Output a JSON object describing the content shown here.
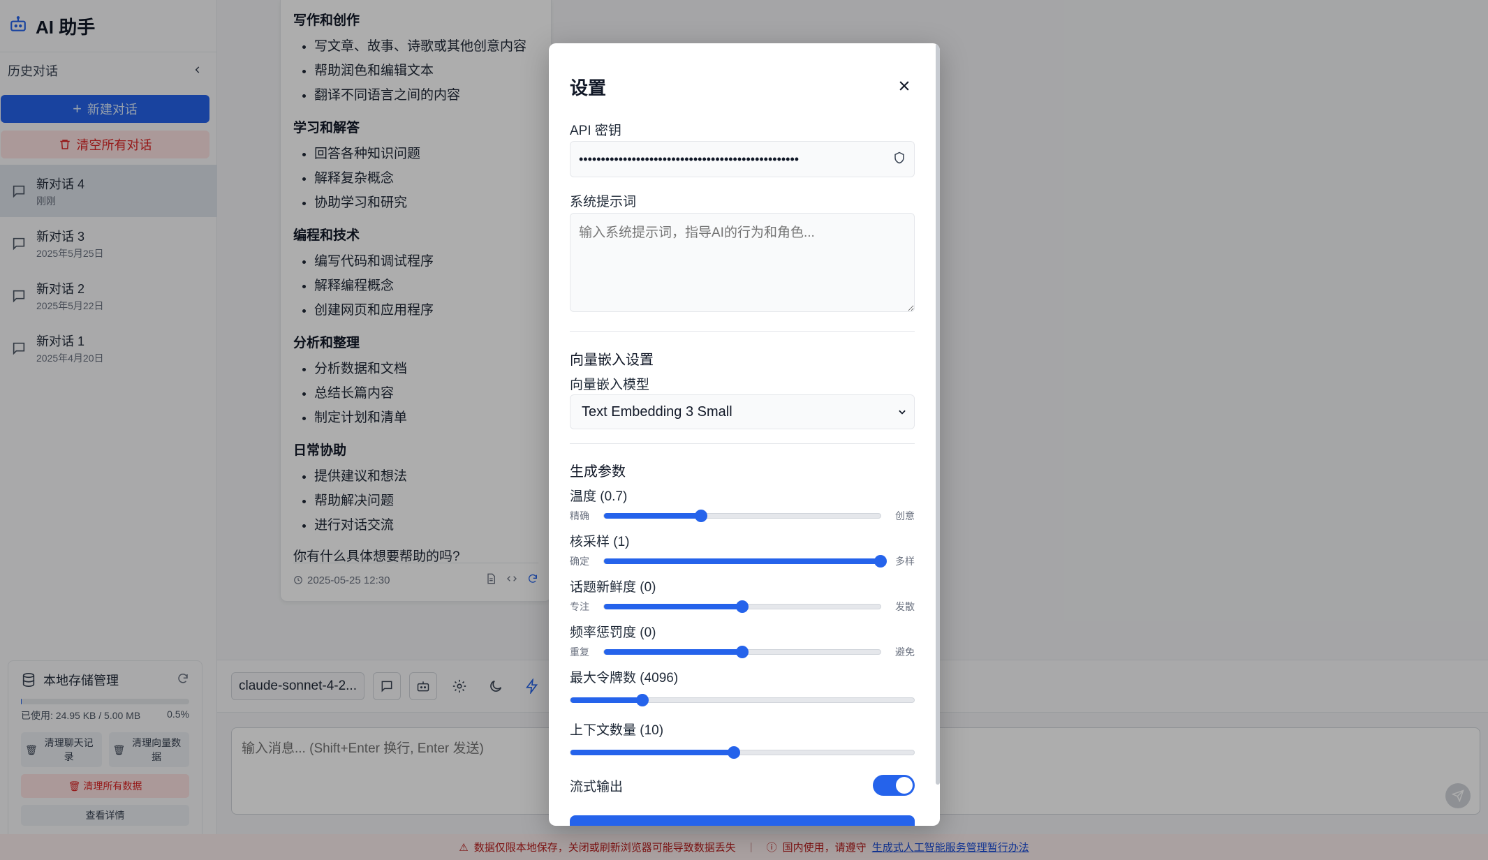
{
  "app": {
    "title": "AI 助手"
  },
  "sidebar": {
    "history_label": "历史对话",
    "new_chat": "新建对话",
    "clear_all": "清空所有对话",
    "conversations": [
      {
        "name": "新对话 4",
        "date": "刚刚",
        "active": true
      },
      {
        "name": "新对话 3",
        "date": "2025年5月25日"
      },
      {
        "name": "新对话 2",
        "date": "2025年5月22日"
      },
      {
        "name": "新对话 1",
        "date": "2025年4月20日"
      }
    ],
    "storage": {
      "title": "本地存储管理",
      "used": "已使用: 24.95 KB / 5.00 MB",
      "percent": "0.5%",
      "usage_fraction": 0.005,
      "clear_chat": "清理聊天记录",
      "clear_vector": "清理向量数据",
      "clear_all_data": "清理所有数据",
      "details": "查看详情"
    }
  },
  "message": {
    "sections": [
      {
        "title": "写作和创作",
        "items": [
          "写文章、故事、诗歌或其他创意内容",
          "帮助润色和编辑文本",
          "翻译不同语言之间的内容"
        ]
      },
      {
        "title": "学习和解答",
        "items": [
          "回答各种知识问题",
          "解释复杂概念",
          "协助学习和研究"
        ]
      },
      {
        "title": "编程和技术",
        "items": [
          "编写代码和调试程序",
          "解释编程概念",
          "创建网页和应用程序"
        ]
      },
      {
        "title": "分析和整理",
        "items": [
          "分析数据和文档",
          "总结长篇内容",
          "制定计划和清单"
        ]
      },
      {
        "title": "日常协助",
        "items": [
          "提供建议和想法",
          "帮助解决问题",
          "进行对话交流"
        ]
      }
    ],
    "question": "你有什么具体想要帮助的吗?",
    "timestamp": "2025-05-25 12:30"
  },
  "toolbar": {
    "model": "claude-sonnet-4-2..."
  },
  "input": {
    "placeholder": "输入消息... (Shift+Enter 换行, Enter 发送)"
  },
  "footer": {
    "warning": "数据仅限本地保存，关闭或刷新浏览器可能导致数据丢失",
    "notice": "国内使用，请遵守",
    "link": "生成式人工智能服务管理暂行办法"
  },
  "settings": {
    "title": "设置",
    "api_key_label": "API 密钥",
    "api_key_value": "••••••••••••••••••••••••••••••••••••••••••••••••••",
    "system_prompt_label": "系统提示词",
    "system_prompt_placeholder": "输入系统提示词，指导AI的行为和角色...",
    "embedding_section": "向量嵌入设置",
    "embedding_model_label": "向量嵌入模型",
    "embedding_model_value": "Text Embedding 3 Small",
    "gen_section": "生成参数",
    "sliders": [
      {
        "label": "温度 (0.7)",
        "left": "精确",
        "right": "创意",
        "value": 0.7,
        "min": 0,
        "max": 2
      },
      {
        "label": "核采样 (1)",
        "left": "确定",
        "right": "多样",
        "value": 1,
        "min": 0,
        "max": 1
      },
      {
        "label": "话题新鲜度 (0)",
        "left": "专注",
        "right": "发散",
        "value": 0,
        "min": -2,
        "max": 2
      },
      {
        "label": "频率惩罚度 (0)",
        "left": "重复",
        "right": "避免",
        "value": 0,
        "min": -2,
        "max": 2
      }
    ],
    "max_tokens_label": "最大令牌数 (4096)",
    "max_tokens_fraction": 0.21,
    "context_label": "上下文数量 (10)",
    "context_fraction": 0.475,
    "stream_label": "流式输出",
    "stream_on": true
  }
}
